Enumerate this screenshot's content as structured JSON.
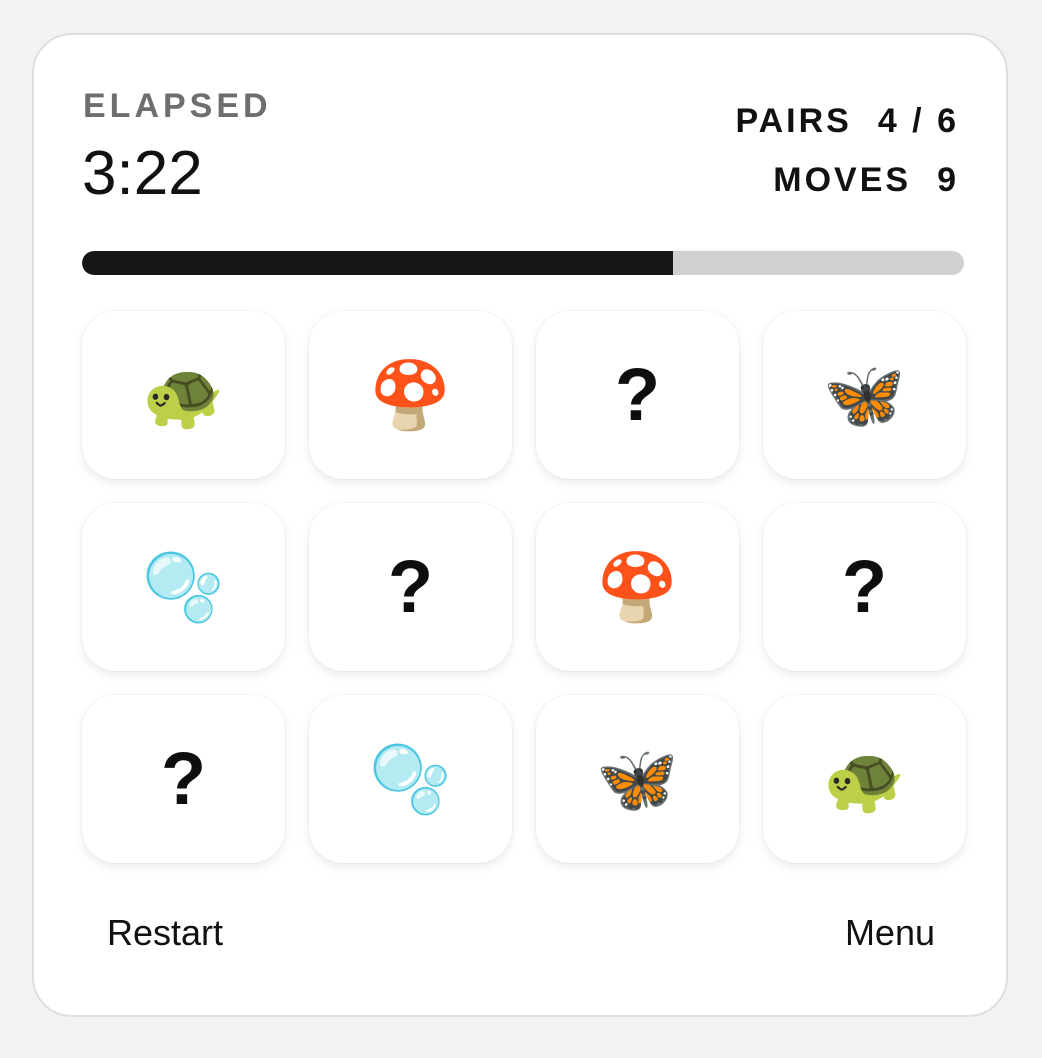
{
  "timer": {
    "label": "ELAPSED",
    "value": "3:22"
  },
  "stats": {
    "pairs_label": "PAIRS",
    "pairs_value": "4 / 6",
    "moves_label": "MOVES",
    "moves_value": "9"
  },
  "progress": {
    "fraction": 0.67,
    "fill_color": "#161616",
    "track_color": "#d0d0d0"
  },
  "tiles": [
    {
      "face": "🐢",
      "state": "matched",
      "icon": "turtle-icon"
    },
    {
      "face": "🍄",
      "state": "matched",
      "icon": "mushroom-icon"
    },
    {
      "face": "?",
      "state": "hidden",
      "icon": "question-mark-icon"
    },
    {
      "face": "🦋",
      "state": "matched",
      "icon": "butterfly-icon"
    },
    {
      "face": "🫧",
      "state": "matched",
      "icon": "bubbles-icon"
    },
    {
      "face": "?",
      "state": "hidden",
      "icon": "question-mark-icon"
    },
    {
      "face": "🍄",
      "state": "matched",
      "icon": "mushroom-icon"
    },
    {
      "face": "?",
      "state": "hidden",
      "icon": "question-mark-icon"
    },
    {
      "face": "?",
      "state": "hidden",
      "icon": "question-mark-icon"
    },
    {
      "face": "🫧",
      "state": "matched",
      "icon": "bubbles-icon"
    },
    {
      "face": "🦋",
      "state": "matched",
      "icon": "butterfly-icon"
    },
    {
      "face": "🐢",
      "state": "matched",
      "icon": "turtle-icon"
    }
  ],
  "footer": {
    "restart_label": "Restart",
    "menu_label": "Menu"
  }
}
